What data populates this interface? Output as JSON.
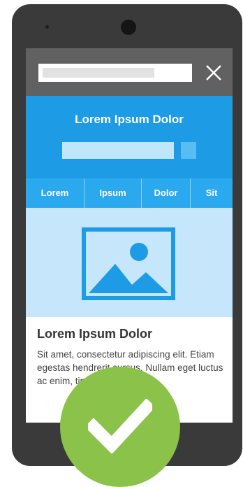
{
  "browser": {
    "close_icon": "close-icon"
  },
  "hero": {
    "title": "Lorem Ipsum Dolor"
  },
  "nav": {
    "items": [
      "Lorem",
      "Ipsum",
      "Dolor",
      "Sit"
    ]
  },
  "image": {
    "icon": "image-placeholder-icon"
  },
  "article": {
    "title": "Lorem Ipsum Dolor",
    "body": "Sit amet, consectetur adipiscing elit. Etiam egestas hendrerit cursus. Nullam eget luctus ac enim, tincidunt ac erat"
  },
  "badge": {
    "icon": "checkmark-icon"
  },
  "colors": {
    "phone_body": "#3a3a3a",
    "url_bar": "#616161",
    "hero": "#1e9be5",
    "nav": "#2aa9ef",
    "image_bg": "#c6e7fb",
    "badge": "#8bc34a"
  }
}
